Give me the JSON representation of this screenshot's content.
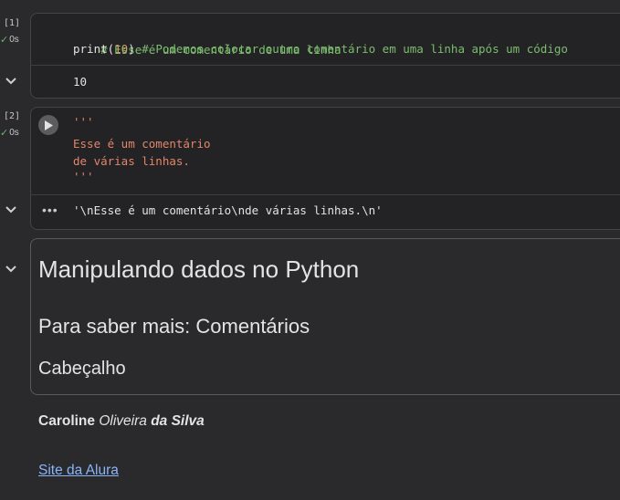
{
  "cells": [
    {
      "exec_count": "[1]",
      "status_time": "0s",
      "code_line1_comment": "# Esse é um comentário de uma linha",
      "code_line2_func": "print(",
      "code_line2_num": "10",
      "code_line2_close": ")",
      "code_line2_comment": " # Podemos colocar outro comentário em uma linha após um código",
      "output": "10"
    },
    {
      "exec_count": "[2]",
      "status_time": "0s",
      "code_lines": [
        "'''",
        "Esse é um comentário",
        "de várias linhas.",
        "'''"
      ],
      "output": "'\\nEsse é um comentário\\nde várias linhas.\\n'"
    }
  ],
  "markdown": {
    "h1": "Manipulando dados no Python",
    "h2": "Para saber mais: Comentários",
    "h3": "Cabeçalho",
    "author_first": "Caroline",
    "author_middle": "Oliveira",
    "author_last": "da Silva",
    "link_text": "Site da Alura"
  },
  "icons": {
    "check": "check-icon",
    "chevron": "chevron-down-icon",
    "run": "play-icon",
    "more": "more-horiz-icon"
  },
  "colors": {
    "background": "#2a2a2c",
    "comment": "#7cbc6e",
    "string": "#e2866a",
    "number": "#c9a063",
    "link": "#8ab4f8",
    "check": "#5bb974"
  }
}
